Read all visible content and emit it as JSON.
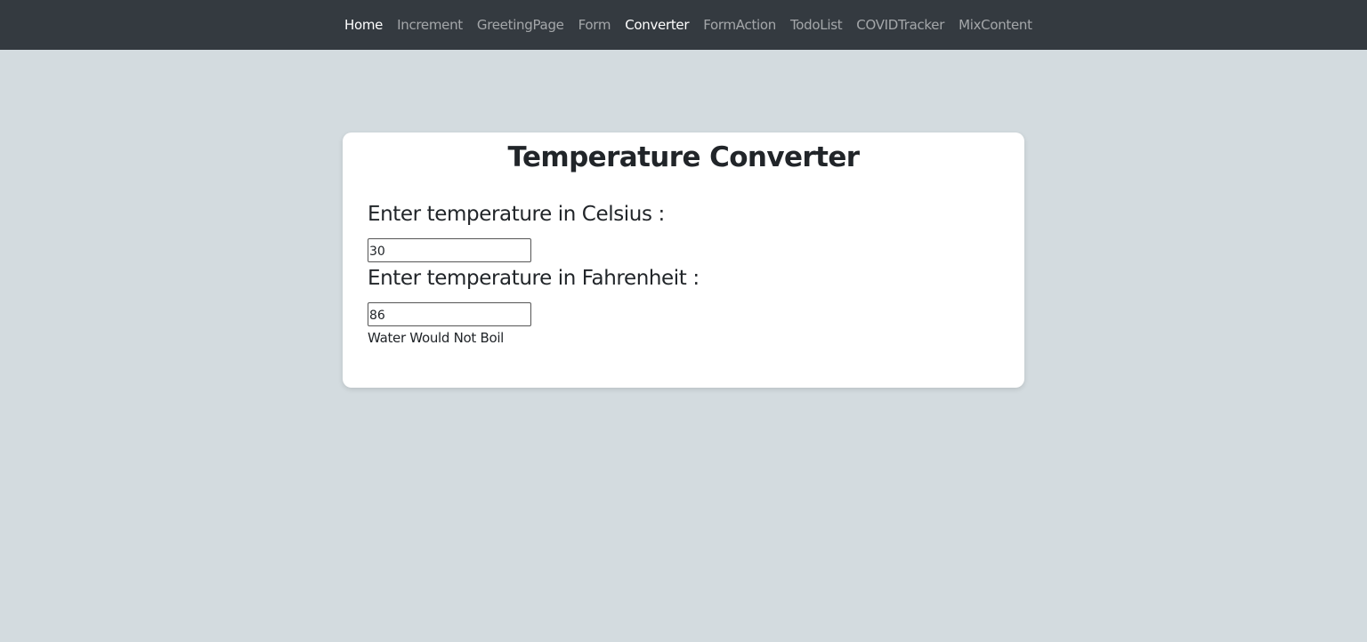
{
  "navbar": {
    "items": [
      {
        "label": "Home",
        "active": true
      },
      {
        "label": "Increment",
        "active": false
      },
      {
        "label": "GreetingPage",
        "active": false
      },
      {
        "label": "Form",
        "active": false
      },
      {
        "label": "Converter",
        "active": true
      },
      {
        "label": "FormAction",
        "active": false
      },
      {
        "label": "TodoList",
        "active": false
      },
      {
        "label": "COVIDTracker",
        "active": false
      },
      {
        "label": "MixContent",
        "active": false
      }
    ]
  },
  "converter": {
    "title": "Temperature Converter",
    "celsius_label": "Enter temperature in Celsius :",
    "celsius_value": "30",
    "fahrenheit_label": "Enter temperature in Fahrenheit :",
    "fahrenheit_value": "86",
    "boil_status": "Water Would Not Boil"
  },
  "colors": {
    "page_background": "#d3dbdf",
    "navbar_background": "#343a40",
    "card_background": "#ffffff",
    "text": "#212529"
  }
}
